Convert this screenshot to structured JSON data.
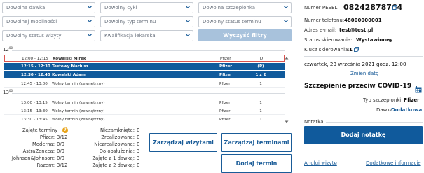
{
  "filters": {
    "dose": "Dowolna dawka",
    "cycle": "Dowolny cykl",
    "vaccine": "Dowolna szczepionka",
    "mobility": "Dowolnej mobilności",
    "term_type": "Dowolny typ terminu",
    "term_status": "Dowolny status terminu",
    "visit_status": "Dowolny status wizyty",
    "qualification": "Kwalifikacja lekarska",
    "clear_label": "Wyczyść filtry"
  },
  "schedule": {
    "hours": [
      "12",
      "13"
    ],
    "hour_suffix": "00",
    "rows_12": [
      {
        "time": "12:00 - 12:15",
        "name": "Kowalski Mirek",
        "vaccine": "Pfizer",
        "dose": "(D)"
      },
      {
        "time": "12:15 - 12:30",
        "name": "Testowy Mariusz",
        "vaccine": "Pfizer",
        "dose": "(P)"
      },
      {
        "time": "12:30 - 12:45",
        "name": "Kowalski Adam",
        "vaccine": "Pfizer",
        "dose": "1 z 2"
      },
      {
        "time": "12:45 - 13:00",
        "name": "Wolny termin (zewnętrzny)",
        "vaccine": "Pfizer",
        "dose": "1"
      }
    ],
    "rows_13": [
      {
        "time": "13:00 - 13:15",
        "name": "Wolny termin (zewnętrzny)",
        "vaccine": "Pfizer",
        "dose": "1"
      },
      {
        "time": "13:15 - 13:30",
        "name": "Wolny termin (zewnętrzny)",
        "vaccine": "Pfizer",
        "dose": "1"
      },
      {
        "time": "13:30 - 13:45",
        "name": "Wolny termin (zewnętrzny)",
        "vaccine": "Pfizer",
        "dose": "1"
      }
    ]
  },
  "stats": {
    "taken_label": "Zajęte terminy",
    "left": [
      {
        "label": "Pfizer:",
        "value": "3/12"
      },
      {
        "label": "Moderna:",
        "value": "0/0"
      },
      {
        "label": "AstraZeneca:",
        "value": "0/0"
      },
      {
        "label": "Johnson&Johnson:",
        "value": "0/0"
      },
      {
        "label": "Razem:",
        "value": "3/12"
      }
    ],
    "right": [
      {
        "label": "Niezamknięte:",
        "value": "0"
      },
      {
        "label": "Zrealizowane:",
        "value": "0"
      },
      {
        "label": "Niezrealizowane:",
        "value": "0"
      },
      {
        "label": "Do obsłużenia:",
        "value": "3"
      },
      {
        "label": "Zajęte z 1 dawką:",
        "value": "3"
      },
      {
        "label": "Zajęte z 2 dawką:",
        "value": "0"
      }
    ]
  },
  "buttons": {
    "manage_visits": "Zarządzaj wizytami",
    "manage_terms": "Zarządzaj terminami",
    "add_term": "Dodaj termin"
  },
  "patient": {
    "pesel_label": "Numer PESEL:",
    "pesel": "08242878764",
    "phone_label": "Numer telefonu:",
    "phone": "48000000001",
    "email_label": "Adres e-mail:",
    "email": "test@test.pl",
    "status_label": "Status skierowania:",
    "status": "Wystawione",
    "key_label": "Klucz skierowania:",
    "key": "1",
    "date": "czwartek, 23 września 2021 godz. 12:00",
    "change_date": "Zmień datę",
    "section_title": "Szczepienie przeciw COVID-19",
    "vaccine_type_label": "Typ szczepionki:",
    "vaccine_type": "Pfizer",
    "dose_label": "Dawka",
    "dose_value": "Dodatkowa",
    "note_label": "Notatka",
    "add_note": "Dodaj notatkę",
    "cancel_visit": "Anuluj wizytę",
    "additional_info": "Dodatkowe informacje"
  },
  "colors": {
    "primary": "#105a9c",
    "clear_disabled": "#a8c2dc",
    "warning": "#e8a317",
    "selected_border": "#d9534f"
  }
}
